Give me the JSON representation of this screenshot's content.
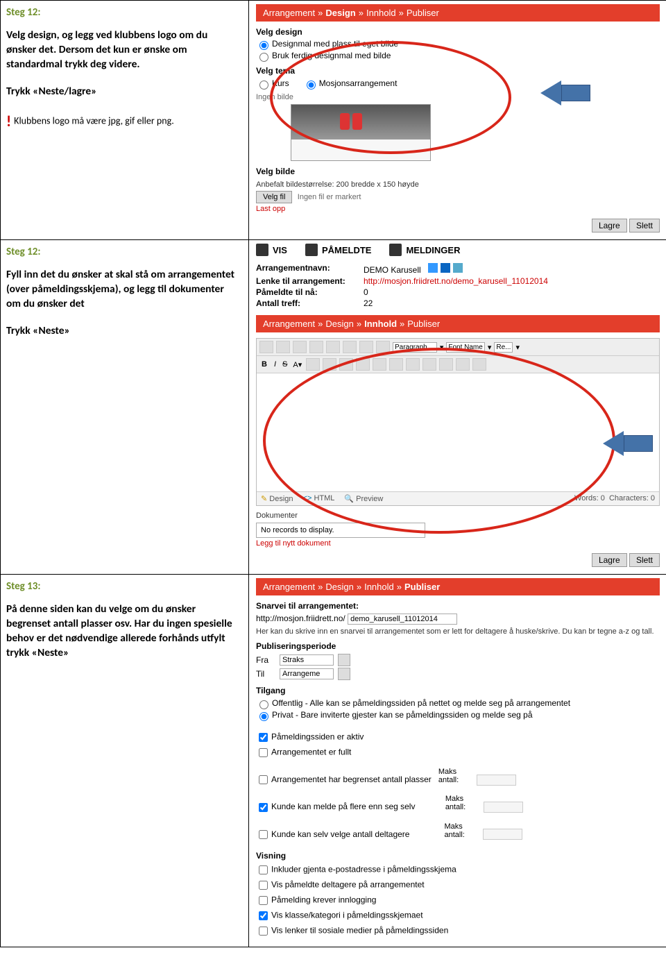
{
  "rows": [
    {
      "step_label": "Steg 12:",
      "body1": "Velg design, og legg ved klubbens logo om du ønsker det. Dersom det kun er ønske om standardmal trykk deg videre.",
      "body2": "Trykk «Neste/lagre»",
      "note": "Klubbens logo må være jpg, gif eller png.",
      "screen": {
        "breadcrumb": {
          "a": "Arrangement",
          "b": "Design",
          "c": "Innhold",
          "d": "Publiser",
          "active": "Design"
        },
        "h_design": "Velg design",
        "r1": "Designmal med plass til eget bilde",
        "r2": "Bruk ferdig designmal med bilde",
        "h_tema": "Velg tema",
        "r3": "Kurs",
        "r4": "Mosjonsarrangement",
        "ingen": "Ingen bilde",
        "h_bilde": "Velg bilde",
        "anbefalt": "Anbefalt bildestørrelse: 200 bredde x 150 høyde",
        "velgfil_btn": "Velg fil",
        "velgfil_txt": "Ingen fil er markert",
        "lastopp": "Last opp",
        "lagre": "Lagre",
        "slett": "Slett"
      }
    },
    {
      "step_label": "Steg 12:",
      "body1": "Fyll inn det du ønsker at skal stå om arrangementet (over påmeldingsskjema), og legg til dokumenter om du ønsker det",
      "body2": "Trykk «Neste»",
      "screen": {
        "tabs": {
          "vis": "VIS",
          "pam": "PÅMELDTE",
          "meld": "MELDINGER"
        },
        "kv": {
          "navn_k": "Arrangementnavn:",
          "navn_v": "DEMO Karusell",
          "lenke_k": "Lenke til arrangement:",
          "lenke_v": "http://mosjon.friidrett.no/demo_karusell_11012014",
          "pam_k": "Påmeldte til nå:",
          "pam_v": "0",
          "treff_k": "Antall treff:",
          "treff_v": "22"
        },
        "breadcrumb": {
          "a": "Arrangement",
          "b": "Design",
          "c": "Innhold",
          "d": "Publiser",
          "active": "Innhold"
        },
        "sel1": "Paragraph ...",
        "sel2": "Font Name",
        "sel3": "Re...",
        "foot_design": "Design",
        "foot_html": "HTML",
        "foot_prev": "Preview",
        "words": "Words: 0",
        "chars": "Characters: 0",
        "dok_h": "Dokumenter",
        "dok_empty": "No records to display.",
        "dok_add": "Legg til nytt dokument",
        "lagre": "Lagre",
        "slett": "Slett"
      }
    },
    {
      "step_label": "Steg 13:",
      "body1": "På denne siden kan du velge om du ønsker begrenset antall plasser osv. Har du ingen spesielle behov er det nødvendige allerede forhånds utfylt trykk «Neste»",
      "screen": {
        "breadcrumb": {
          "a": "Arrangement",
          "b": "Design",
          "c": "Innhold",
          "d": "Publiser",
          "active": "Publiser"
        },
        "snarvei_h": "Snarvei til arrangementet:",
        "url_prefix": "http://mosjon.friidrett.no/",
        "url_value": "demo_karusell_11012014",
        "url_help": "Her kan du skrive inn en snarvei til arrangementet som er lett for deltagere å huske/skrive. Du kan br tegne a-z og tall.",
        "pub_h": "Publiseringsperiode",
        "fra": "Fra",
        "fra_v": "Straks",
        "til": "Til",
        "til_v": "Arrangeme",
        "tilgang_h": "Tilgang",
        "tilgang1": "Offentlig - Alle kan se påmeldingssiden på nettet og melde seg på arrangementet",
        "tilgang2": "Privat - Bare inviterte gjester kan se påmeldingssiden og melde seg på",
        "cb1": "Påmeldingssiden er aktiv",
        "cb2": "Arrangementet er fullt",
        "cb3": "Arrangementet har begrenset antall plasser",
        "cb4": "Kunde kan melde på flere enn seg selv",
        "cb5": "Kunde kan selv velge antall deltagere",
        "maks": "Maks antall:",
        "visning_h": "Visning",
        "v1": "Inkluder gjenta e-postadresse i påmeldingsskjema",
        "v2": "Vis påmeldte deltagere på arrangementet",
        "v3": "Påmelding krever innlogging",
        "v4": "Vis klasse/kategori i påmeldingsskjemaet",
        "v5": "Vis lenker til sosiale medier på påmeldingssiden"
      }
    }
  ]
}
